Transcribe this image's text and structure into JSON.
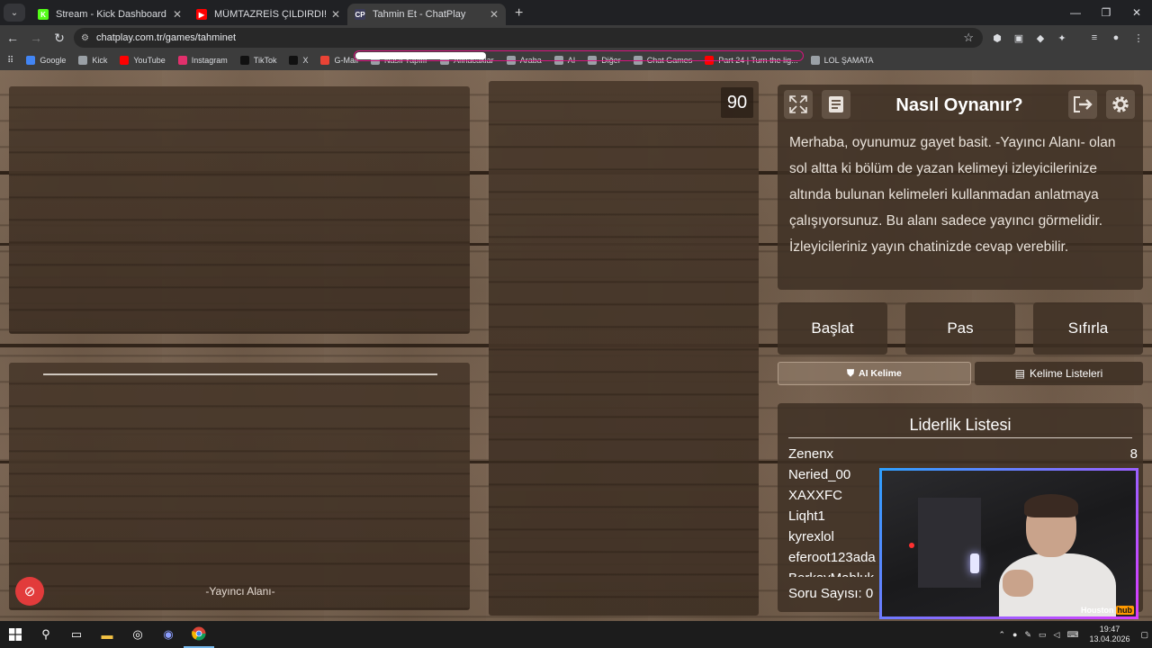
{
  "browser": {
    "tabs": [
      {
        "title": "Stream - Kick Dashboard",
        "favicon_color": "#53fc18",
        "favicon_char": "K"
      },
      {
        "title": "MÜMTAZREİS ÇILDIRDI! OKAN",
        "favicon_color": "#ff0000",
        "favicon_char": "▶"
      },
      {
        "title": "Tahmin Et - ChatPlay",
        "favicon_color": "#3b3b58",
        "favicon_char": "CP"
      }
    ],
    "url": "chatplay.com.tr/games/tahminet",
    "bookmarks": [
      {
        "label": "Google",
        "color": "#4285f4"
      },
      {
        "label": "Kick",
        "color": "#9aa0a6"
      },
      {
        "label": "YouTube",
        "color": "#ff0000"
      },
      {
        "label": "Instagram",
        "color": "#e1306c"
      },
      {
        "label": "TikTok",
        "color": "#111111"
      },
      {
        "label": "X",
        "color": "#111111"
      },
      {
        "label": "G-Mail",
        "color": "#ea4335"
      },
      {
        "label": "Nasıl Yapılır",
        "color": "#9aa0a6"
      },
      {
        "label": "Alınacaklar",
        "color": "#9aa0a6"
      },
      {
        "label": "Araba",
        "color": "#9aa0a6"
      },
      {
        "label": "AI",
        "color": "#9aa0a6"
      },
      {
        "label": "Diğer",
        "color": "#9aa0a6"
      },
      {
        "label": "Chat Games",
        "color": "#9aa0a6"
      },
      {
        "label": "Part 24 | Turn the lig...",
        "color": "#ff0000"
      },
      {
        "label": "LOL ŞAMATA",
        "color": "#9aa0a6"
      }
    ]
  },
  "game": {
    "timer": "90",
    "streamer_area_label": "-Yayıncı Alanı-",
    "help": {
      "title": "Nasıl Oynanır?",
      "text": "Merhaba, oyunumuz gayet basit. -Yayıncı Alanı- olan sol altta ki bölüm de yazan kelimeyi izleyicilerinize altında bulunan kelimeleri kullanmadan anlatmaya çalışıyorsunuz. Bu alanı sadece yayıncı görmelidir. İzleyicileriniz yayın chatinizde cevap verebilir."
    },
    "buttons": {
      "start": "Başlat",
      "pass": "Pas",
      "reset": "Sıfırla",
      "ai_word": "AI Kelime",
      "word_lists": "Kelime Listeleri"
    },
    "leaderboard": {
      "title": "Liderlik Listesi",
      "rows": [
        {
          "name": "Zenenx",
          "score": "8"
        },
        {
          "name": "Neried_00",
          "score": ""
        },
        {
          "name": "XAXXFC",
          "score": ""
        },
        {
          "name": "Liqht1",
          "score": ""
        },
        {
          "name": "kyrexlol",
          "score": ""
        },
        {
          "name": "eferoot123ada",
          "score": ""
        },
        {
          "name": "BerkayMabluk",
          "score": ""
        }
      ],
      "question_count": "Soru Sayısı: 0"
    }
  },
  "webcam": {
    "brand_a": "Houston",
    "brand_b": "hub"
  },
  "taskbar": {
    "time": "19:47",
    "date": "13.04.2026"
  }
}
